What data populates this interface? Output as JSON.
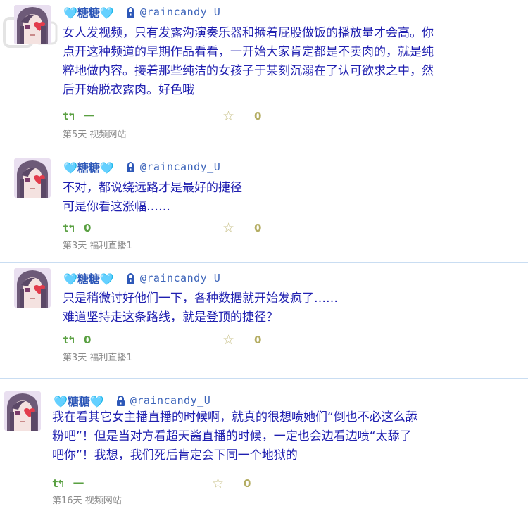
{
  "posts": [
    {
      "name": "🩵糖糖🩵",
      "handle": "@raincandy_U",
      "text": "女人发视频，只有发露沟演奏乐器和撅着屁股做饭的播放量才会高。你\n点开这种频道的早期作品看看，一开始大家肯定都是不卖肉的，就是纯\n粹地做内容。接着那些纯洁的女孩子于某刻沉溺在了认可欲求之中，然\n后开始脱衣露肉。好色哦",
      "retweet_count": "一",
      "fav_count": "0",
      "time": "第5天",
      "source": "视频网站"
    },
    {
      "name": "🩵糖糖🩵",
      "handle": "@raincandy_U",
      "text": "不对，都说绕远路才是最好的捷径\n可是你看这涨幅……",
      "retweet_count": "0",
      "fav_count": "0",
      "time": "第3天",
      "source": "福利直播1"
    },
    {
      "name": "🩵糖糖🩵",
      "handle": "@raincandy_U",
      "text": "只是稍微讨好他们一下，各种数据就开始发疯了……\n难道坚持走这条路线，就是登顶的捷径？",
      "retweet_count": "0",
      "fav_count": "0",
      "time": "第3天",
      "source": "福利直播1"
    },
    {
      "name": "🩵糖糖🩵",
      "handle": "@raincandy_U",
      "text": "我在看其它女主播直播的时候啊，就真的很想喷她们“倒也不必这么舔\n粉吧”！但是当对方看超天酱直播的时候，一定也会边看边喷“太舔了\n吧你”！我想，我们死后肯定会下同一个地狱的",
      "retweet_count": "一",
      "fav_count": "0",
      "time": "第16天",
      "source": "视频网站"
    }
  ],
  "icons": {
    "retweet": "retweet-icon",
    "favorite": "star-icon",
    "lock": "lock-icon",
    "avatar": "avatar-girl-eyepatch"
  },
  "colors": {
    "name": "#2d58b8",
    "heart": "#38b9d6",
    "text": "#1f1fb0",
    "retweet": "#5aa042",
    "star": "#c9c28a",
    "meta": "#8a8a8a",
    "separator": "#c9ddf2"
  }
}
